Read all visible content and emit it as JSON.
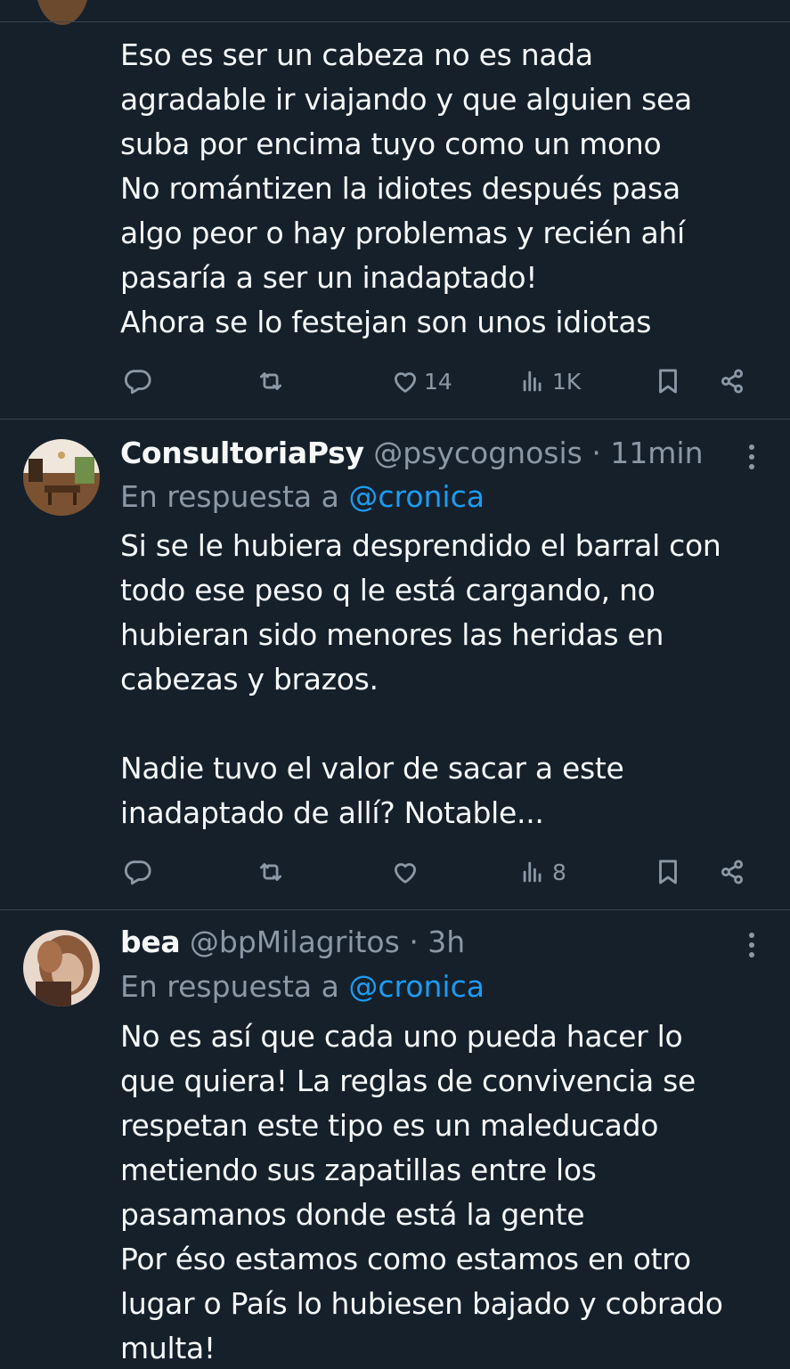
{
  "tweets": [
    {
      "text": "Eso es ser un cabeza no es nada\nagradable ir viajando y que alguien sea\nsuba por encima tuyo como un mono\nNo romántizen la idiotes después pasa\nalgo peor o hay problemas y recién ahí\npasaría a ser un inadaptado!\nAhora se lo festejan son unos idiotas",
      "likes": "14",
      "views": "1K"
    },
    {
      "name": "ConsultoriaPsy",
      "handle": "@psycognosis",
      "time": "· 11min",
      "reply_prefix": "En respuesta a",
      "reply_to": "@cronica",
      "text": "Si se le hubiera desprendido el barral con\ntodo ese peso q le está cargando, no\nhubieran sido menores las heridas en\ncabezas y brazos.\n\nNadie tuvo el valor de sacar a este\ninadaptado de allí? Notable...",
      "likes": "",
      "views": "8"
    },
    {
      "name": "bea",
      "handle": "@bpMilagritos",
      "time": "· 3h",
      "reply_prefix": "En respuesta a",
      "reply_to": "@cronica",
      "text": "No es así que cada uno pueda hacer lo\nque quiera! La reglas de convivencia se\nrespetan este tipo es un maleducado\nmetiendo sus zapatillas entre los\npasamanos donde está la gente\nPor éso estamos como estamos en otro\nlugar o País lo hubiesen bajado y cobrado\nmulta!"
    }
  ],
  "icons": [
    "reply-icon",
    "retweet-icon",
    "like-icon",
    "views-icon",
    "bookmark-icon",
    "share-icon",
    "more-icon"
  ],
  "colors": {
    "background": "#15202b",
    "text": "#f7f9f9",
    "secondary": "#8b98a5",
    "link": "#1d9bf0",
    "divider": "#38444d"
  }
}
